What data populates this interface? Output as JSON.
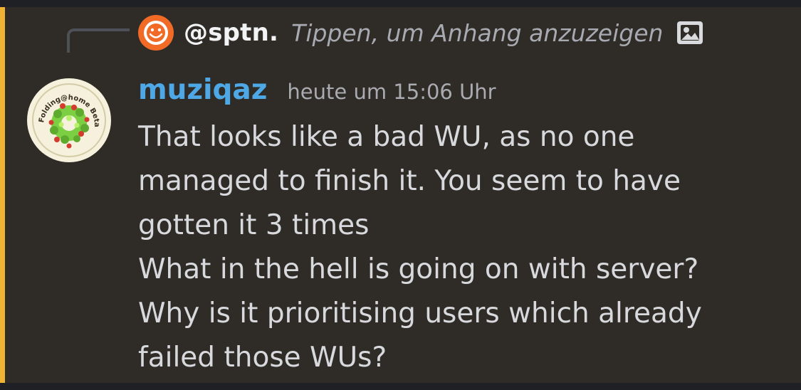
{
  "reply": {
    "author": "@sptn.",
    "preview": "Tippen, um Anhang anzuzeigen",
    "avatar_icon": "smiley-icon",
    "attachment_icon": "image-icon"
  },
  "message": {
    "username": "muziqaz",
    "timestamp": "heute um 15:06 Uhr",
    "lines": [
      "That looks like a bad WU, as no one",
      "managed to finish it. You seem to have",
      "gotten it 3 times",
      "What in the hell is going on with server?",
      "Why is it prioritising users which already",
      "failed those WUs?"
    ],
    "avatar": {
      "badge_text": "Folding@home Beta-tester"
    }
  },
  "colors": {
    "highlight": "#f0b232",
    "username": "#4ea8e6",
    "message_background": "#2f2b27"
  }
}
